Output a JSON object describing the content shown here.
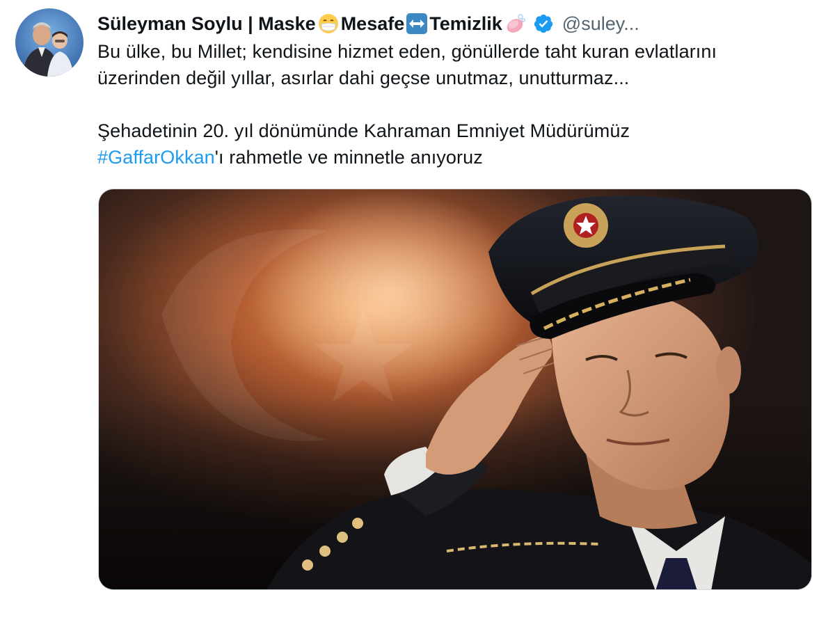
{
  "tweet": {
    "author": {
      "name_parts": [
        "Süleyman Soylu | Maske",
        " Mesafe",
        " Temizlik"
      ],
      "handle": "@suley...",
      "emoji_icons": [
        "face-with-medical-mask-icon",
        "left-right-arrow-icon",
        "soap-icon"
      ],
      "verified": true
    },
    "text": {
      "line1": "Bu ülke, bu Millet; kendisine hizmet eden, gönüllerde taht kuran evlatlarını",
      "line2": "üzerinden değil yıllar, asırlar dahi geçse unutmaz, unutturmaz...",
      "line3": "Şehadetinin 20. yıl dönümünde Kahraman Emniyet Müdürümüz",
      "hashtag": "#GaffarOkkan",
      "line4_suffix": "'ı rahmetle ve minnetle anıyoruz"
    },
    "media": {
      "description_icon": "saluting-officer-photo"
    }
  },
  "colors": {
    "link": "#1d9bf0",
    "verified": "#1d9bf0",
    "text": "#0f1419",
    "muted": "#536471"
  }
}
